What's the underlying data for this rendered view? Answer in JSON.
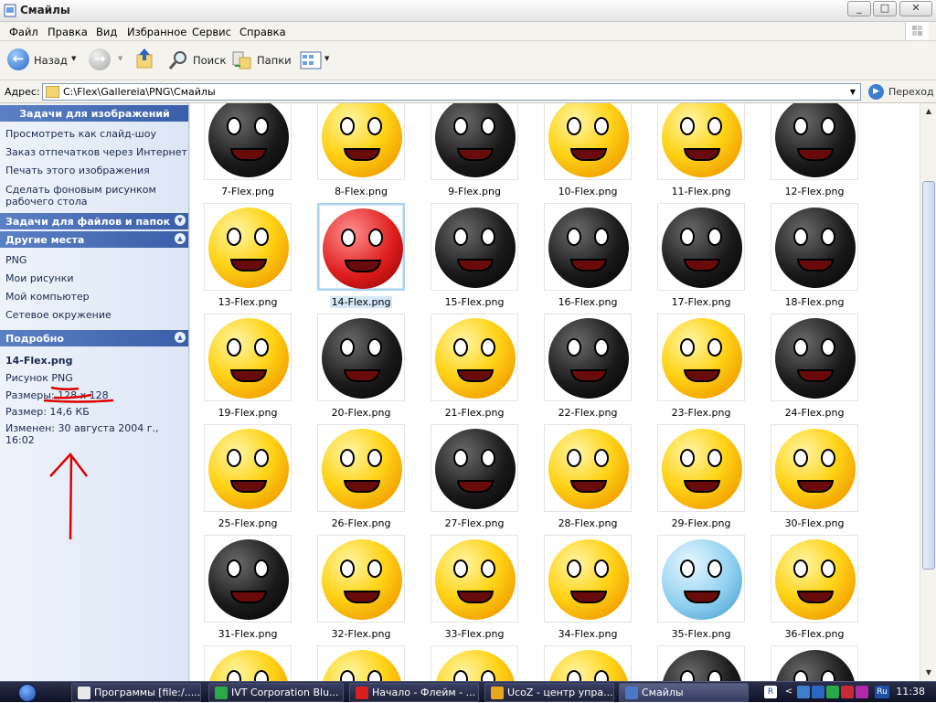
{
  "window": {
    "title": "Смайлы",
    "min": "_",
    "max": "□",
    "close": "✕"
  },
  "menu": [
    "Файл",
    "Правка",
    "Вид",
    "Избранное",
    "Сервис",
    "Справка"
  ],
  "toolbar": {
    "back": "Назад",
    "search": "Поиск",
    "folders": "Папки"
  },
  "address": {
    "label": "Адрес:",
    "value": "C:\\Flex\\Gallereia\\PNG\\Смайлы",
    "go": "Переход"
  },
  "panes": {
    "image_tasks": {
      "title": "Задачи для изображений",
      "links": [
        "Просмотреть как слайд-шоу",
        "Заказ отпечатков через Интернет",
        "Печать этого изображения",
        "Сделать фоновым рисунком рабочего стола"
      ]
    },
    "file_tasks": {
      "title": "Задачи для файлов и папок"
    },
    "other_places": {
      "title": "Другие места",
      "links": [
        "PNG",
        "Мои рисунки",
        "Мой компьютер",
        "Сетевое окружение"
      ]
    },
    "details": {
      "title": "Подробно",
      "name": "14-Flex.png",
      "type": "Рисунок PNG",
      "dims": "Размеры: 128 x 128",
      "size": "Размер: 14,6 КБ",
      "modified": "Изменен: 30 августа 2004 г., 16:02"
    }
  },
  "files": [
    {
      "name": "7-Flex.png",
      "color": "k"
    },
    {
      "name": "8-Flex.png",
      "color": "y"
    },
    {
      "name": "9-Flex.png",
      "color": "k"
    },
    {
      "name": "10-Flex.png",
      "color": "y"
    },
    {
      "name": "11-Flex.png",
      "color": "y"
    },
    {
      "name": "12-Flex.png",
      "color": "k"
    },
    {
      "name": "13-Flex.png",
      "color": "y"
    },
    {
      "name": "14-Flex.png",
      "color": "r",
      "selected": true
    },
    {
      "name": "15-Flex.png",
      "color": "k"
    },
    {
      "name": "16-Flex.png",
      "color": "k"
    },
    {
      "name": "17-Flex.png",
      "color": "k"
    },
    {
      "name": "18-Flex.png",
      "color": "k"
    },
    {
      "name": "19-Flex.png",
      "color": "y"
    },
    {
      "name": "20-Flex.png",
      "color": "k"
    },
    {
      "name": "21-Flex.png",
      "color": "y"
    },
    {
      "name": "22-Flex.png",
      "color": "k"
    },
    {
      "name": "23-Flex.png",
      "color": "y"
    },
    {
      "name": "24-Flex.png",
      "color": "k"
    },
    {
      "name": "25-Flex.png",
      "color": "y"
    },
    {
      "name": "26-Flex.png",
      "color": "y"
    },
    {
      "name": "27-Flex.png",
      "color": "k"
    },
    {
      "name": "28-Flex.png",
      "color": "y"
    },
    {
      "name": "29-Flex.png",
      "color": "y"
    },
    {
      "name": "30-Flex.png",
      "color": "y"
    },
    {
      "name": "31-Flex.png",
      "color": "k"
    },
    {
      "name": "32-Flex.png",
      "color": "y"
    },
    {
      "name": "33-Flex.png",
      "color": "y"
    },
    {
      "name": "34-Flex.png",
      "color": "y"
    },
    {
      "name": "35-Flex.png",
      "color": "b"
    },
    {
      "name": "36-Flex.png",
      "color": "y"
    },
    {
      "name": "",
      "color": "y"
    },
    {
      "name": "",
      "color": "y"
    },
    {
      "name": "",
      "color": "y"
    },
    {
      "name": "",
      "color": "y"
    },
    {
      "name": "",
      "color": "k"
    },
    {
      "name": "",
      "color": "k"
    }
  ],
  "taskbar": {
    "items": [
      {
        "label": "Программы [file:/.....",
        "color": "#e8e8e8"
      },
      {
        "label": "IVT Corporation Blu...",
        "color": "#2aa84a"
      },
      {
        "label": "Начало - Флейм - ...",
        "color": "#d81e1e"
      },
      {
        "label": "UcoZ - центр упра...",
        "color": "#e8a81e"
      },
      {
        "label": "Смайлы",
        "color": "#4a78c8",
        "active": true
      }
    ],
    "lang": "Ru",
    "clock": "11:38"
  }
}
